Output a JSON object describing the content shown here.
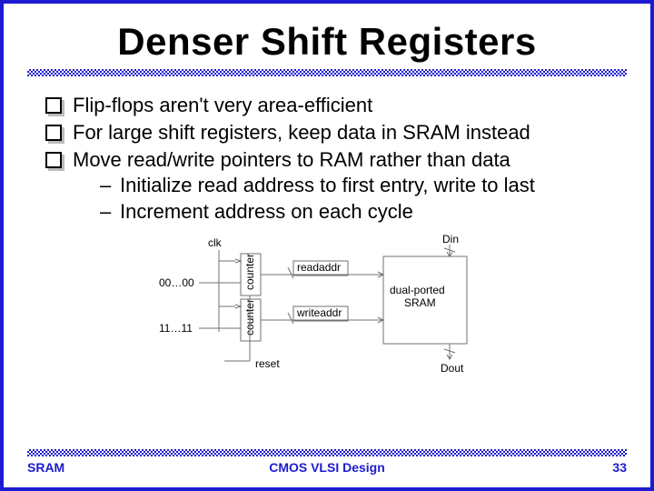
{
  "title": "Denser Shift Registers",
  "bullets": [
    "Flip-flops aren't very area-efficient",
    "For large shift registers, keep data in SRAM instead",
    "Move read/write pointers to RAM rather than data"
  ],
  "subbullets": [
    "Initialize read address to first entry, write to last",
    "Increment address on each cycle"
  ],
  "diagram": {
    "clk": "clk",
    "counter1": "counter",
    "counter2": "counter",
    "init1": "00…00",
    "init2": "11…11",
    "reset": "reset",
    "readaddr": "readaddr",
    "writeaddr": "writeaddr",
    "sram": "dual-ported SRAM",
    "din": "Din",
    "dout": "Dout"
  },
  "footer": {
    "left": "SRAM",
    "center": "CMOS VLSI Design",
    "right": "33"
  }
}
